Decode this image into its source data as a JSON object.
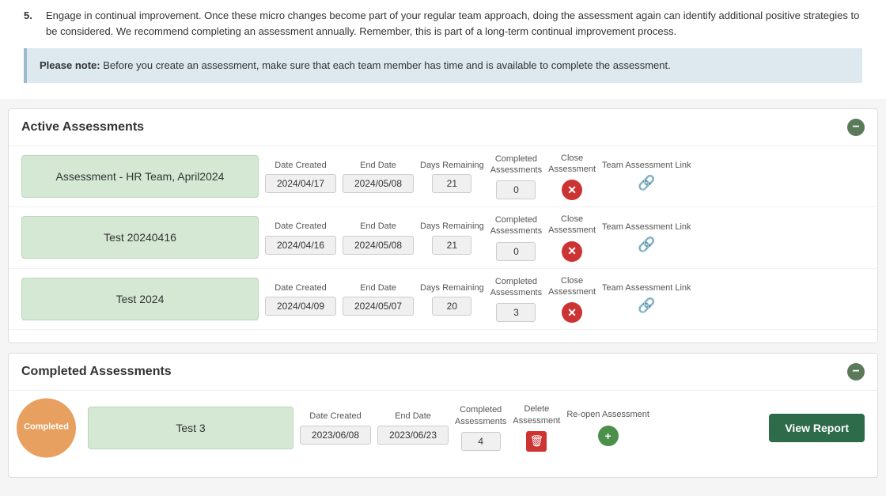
{
  "top": {
    "step5": {
      "number": "5.",
      "text": "Engage in continual improvement. Once these micro changes become part of your regular team approach, doing the assessment again can identify additional positive strategies to be considered. We recommend completing an assessment annually. Remember, this is part of a long-term continual improvement process."
    },
    "note": {
      "label": "Please note:",
      "text": " Before you create an assessment, make sure that each team member has time and is available to complete the assessment."
    }
  },
  "active": {
    "title": "Active Assessments",
    "collapse_label": "−",
    "columns": {
      "date_created": "Date Created",
      "end_date": "End Date",
      "days_remaining": "Days Remaining",
      "completed_assessments": "Completed\nAssessments",
      "close_assessment": "Close\nAssessment",
      "team_link": "Team Assessment Link"
    },
    "rows": [
      {
        "name": "Assessment - HR Team, April2024",
        "date_created": "2024/04/17",
        "end_date": "2024/05/08",
        "days_remaining": "21",
        "completed": "0"
      },
      {
        "name": "Test 20240416",
        "date_created": "2024/04/16",
        "end_date": "2024/05/08",
        "days_remaining": "21",
        "completed": "0"
      },
      {
        "name": "Test 2024",
        "date_created": "2024/04/09",
        "end_date": "2024/05/07",
        "days_remaining": "20",
        "completed": "3"
      }
    ]
  },
  "completed": {
    "title": "Completed Assessments",
    "collapse_label": "−",
    "overlay_label": "Completed",
    "columns": {
      "date_created": "Date Created",
      "end_date": "End Date",
      "completed_assessments": "Completed\nAssessments",
      "delete_assessment": "Delete\nAssessment",
      "reopen_assessment": "Re-open\nAssessment"
    },
    "view_report_label": "View Report",
    "rows": [
      {
        "name": "Test 3",
        "date_created": "2023/06/08",
        "end_date": "2023/06/23",
        "completed": "4"
      }
    ]
  }
}
